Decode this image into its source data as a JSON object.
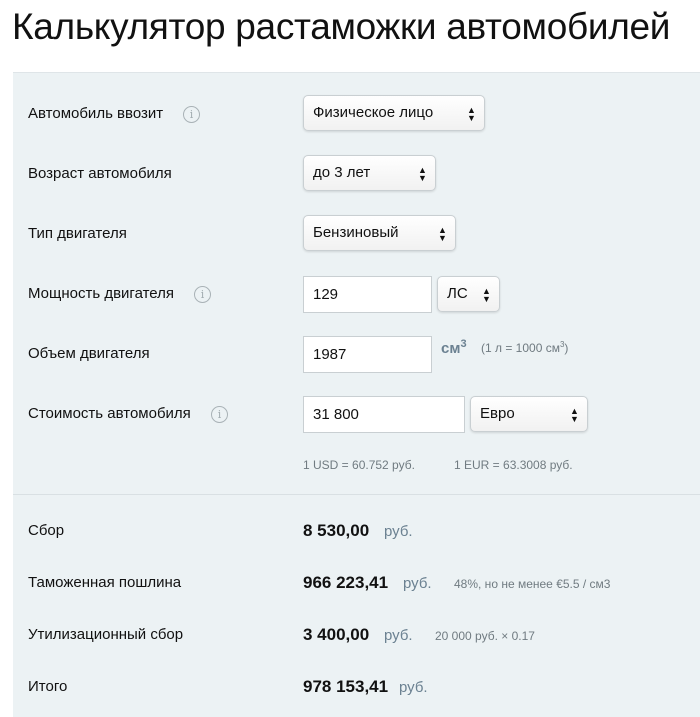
{
  "title": "Калькулятор растаможки автомобилей",
  "form": {
    "importer": {
      "label": "Автомобиль ввозит",
      "value": "Физическое лицо"
    },
    "age": {
      "label": "Возраст автомобиля",
      "value": "до 3 лет"
    },
    "engine_type": {
      "label": "Тип двигателя",
      "value": "Бензиновый"
    },
    "power": {
      "label": "Мощность двигателя",
      "value": "129",
      "unit": "ЛС"
    },
    "volume": {
      "label": "Объем двигателя",
      "value": "1987",
      "unit": "см",
      "unit_exp": "3",
      "hint": "(1 л = 1000 см",
      "hint_exp": "3",
      "hint_close": ")"
    },
    "price": {
      "label": "Стоимость автомобиля",
      "value": "31 800",
      "currency": "Евро"
    },
    "rates": {
      "usd": "1 USD = 60.752 руб.",
      "eur": "1 EUR = 63.3008 руб."
    }
  },
  "results": [
    {
      "label": "Сбор",
      "value": "8 530,00",
      "currency": "руб.",
      "note": ""
    },
    {
      "label": "Таможенная пошлина",
      "value": "966 223,41",
      "currency": "руб.",
      "note": "48%, но не менее €5.5 / см3"
    },
    {
      "label": "Утилизационный сбор",
      "value": "3 400,00",
      "currency": "руб.",
      "note": "20 000 руб. × 0.17"
    },
    {
      "label": "Итого",
      "value": "978 153,41",
      "currency": "руб.",
      "note": ""
    }
  ],
  "icons": {
    "info": "info-icon",
    "select_arrows": "up-down-arrows-icon"
  },
  "colors": {
    "panel": "#ecf2f4",
    "unit_text": "#6b8191"
  }
}
